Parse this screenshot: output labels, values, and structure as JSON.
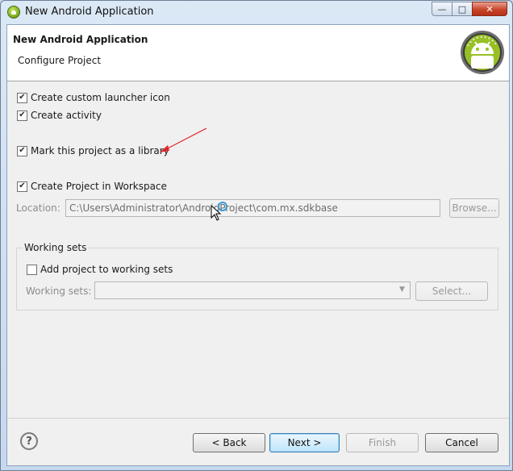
{
  "window": {
    "title": "New Android Application",
    "buttons": {
      "minimize": "—",
      "maximize": "□",
      "close": "✕"
    }
  },
  "header": {
    "title": "New Android Application",
    "subtitle": "Configure Project",
    "logo_icon": "android-logo-icon"
  },
  "options": {
    "custom_launcher_icon": {
      "label": "Create custom launcher icon",
      "checked": true
    },
    "create_activity": {
      "label": "Create activity",
      "checked": true
    },
    "mark_library": {
      "label": "Mark this project as a library",
      "checked": true
    },
    "create_in_workspace": {
      "label": "Create Project in Workspace",
      "checked": true
    }
  },
  "location": {
    "label": "Location:",
    "value": "C:\\Users\\Administrator\\AndroidProject\\com.mx.sdkbase",
    "browse_label": "Browse..."
  },
  "working_sets": {
    "group_title": "Working sets",
    "add_label": "Add project to working sets",
    "add_checked": false,
    "sets_label": "Working sets:",
    "sets_value": "",
    "select_label": "Select..."
  },
  "footer": {
    "help_icon": "help-icon",
    "back_label": "< Back",
    "next_label": "Next >",
    "finish_label": "Finish",
    "cancel_label": "Cancel"
  },
  "colors": {
    "titlebar": "#c6d8ee",
    "annotation_arrow": "#e0282a",
    "android_green": "#97c024"
  }
}
